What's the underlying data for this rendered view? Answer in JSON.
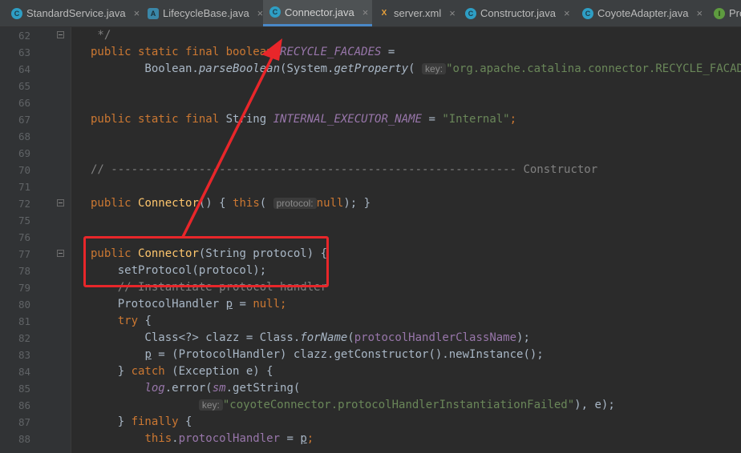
{
  "tabs": [
    {
      "label": "StandardService.java",
      "icon": "C",
      "active": false
    },
    {
      "label": "LifecycleBase.java",
      "icon": "A",
      "active": false
    },
    {
      "label": "Connector.java",
      "icon": "C",
      "active": true
    },
    {
      "label": "server.xml",
      "icon": "X",
      "active": false
    },
    {
      "label": "Constructor.java",
      "icon": "C",
      "active": false
    },
    {
      "label": "CoyoteAdapter.java",
      "icon": "C",
      "active": false
    },
    {
      "label": "Pro",
      "icon": "I",
      "active": false
    }
  ],
  "close_glyph": "×",
  "line_numbers": [
    "62",
    "63",
    "64",
    "65",
    "66",
    "67",
    "68",
    "69",
    "70",
    "71",
    "72",
    "75",
    "76",
    "77",
    "78",
    "79",
    "80",
    "81",
    "82",
    "83",
    "84",
    "85",
    "86",
    "87",
    "88"
  ],
  "code": {
    "l62": " */",
    "l63_kw": "public static final boolean ",
    "l63_fi": "RECYCLE_FACADES",
    "l63_rest": " =",
    "l64_a": "        Boolean.",
    "l64_b": "parseBoolean",
    "l64_c": "(System.",
    "l64_d": "getProperty",
    "l64_e": "(",
    "l64_hint": "key:",
    "l64_str": "\"org.apache.catalina.connector.RECYCLE_FACADES\"",
    "l64_end": ",",
    "l67_kw": "public static final ",
    "l67_type": "String ",
    "l67_fi": "INTERNAL_EXECUTOR_NAME",
    "l67_eq": " = ",
    "l67_str": "\"Internal\"",
    "l67_end": ";",
    "l70": "// ------------------------------------------------------------ Constructor",
    "l72_kw": "public ",
    "l72_fn": "Connector",
    "l72_b": "() ",
    "l72_c": "{ ",
    "l72_this": "this",
    "l72_d": "( ",
    "l72_hint": "protocol:",
    "l72_null": "null",
    "l72_e": "); }",
    "l77_kw": "public ",
    "l77_fn": "Connector",
    "l77_rest": "(String protocol) {",
    "l78": "    setProtocol(protocol);",
    "l79": "    // Instantiate protocol handler",
    "l80_a": "    ProtocolHandler ",
    "l80_p": "p",
    "l80_b": " = ",
    "l80_null": "null",
    "l80_end": ";",
    "l81_kw": "    try",
    "l81_rest": " {",
    "l82_a": "        Class<?> clazz = Class.",
    "l82_fi": "forName",
    "l82_b": "(",
    "l82_fl": "protocolHandlerClassName",
    "l82_end": ");",
    "l83_a": "        ",
    "l83_p": "p",
    "l83_b": " = (ProtocolHandler) clazz.getConstructor().newInstance();",
    "l84_a": "    } ",
    "l84_kw": "catch",
    "l84_b": " (Exception e) {",
    "l85_a": "        ",
    "l85_log": "log",
    "l85_b": ".error(",
    "l85_sm": "sm",
    "l85_c": ".getString(",
    "l86_pad": "                ",
    "l86_hint": "key:",
    "l86_str": "\"coyoteConnector.protocolHandlerInstantiationFailed\"",
    "l86_end": "), e);",
    "l87_a": "    } ",
    "l87_kw": "finally",
    "l87_b": " {",
    "l88_a": "        ",
    "l88_this": "this",
    "l88_b": ".",
    "l88_fl": "protocolHandler",
    "l88_c": " = ",
    "l88_p": "p",
    "l88_end": ";"
  },
  "colors": {
    "annotation": "#e8262a",
    "keyword": "#cc7832",
    "method": "#ffc66d",
    "string": "#6a8759",
    "field": "#9876aa"
  }
}
